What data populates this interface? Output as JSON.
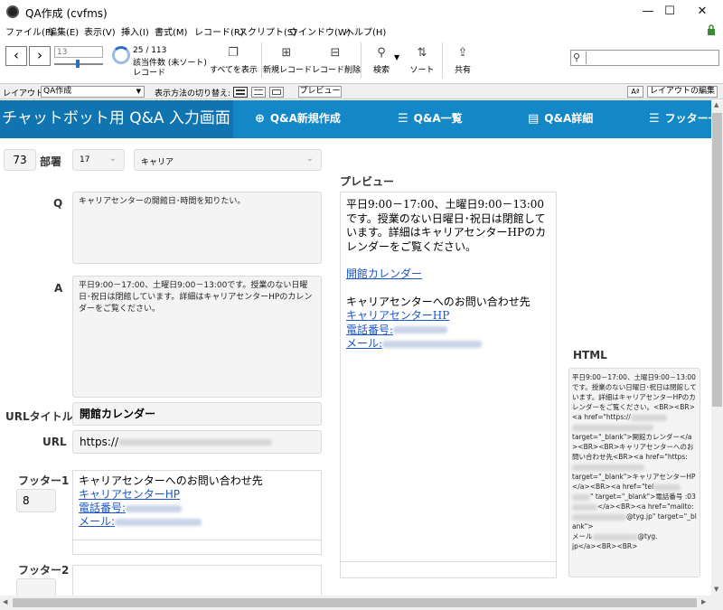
{
  "window": {
    "title": "QA作成 (cvfms)",
    "minimize": "—",
    "maximize": "☐",
    "close": "✕"
  },
  "menu": [
    "ファイル(F)",
    "編集(E)",
    "表示(V)",
    "挿入(I)",
    "書式(M)",
    "レコード(R)",
    "スクリプト(S)",
    "ウインドウ(W)",
    "ヘルプ(H)"
  ],
  "toolbar": {
    "record_number": "13",
    "found_count": "25 / 113",
    "found_label": "該当件数 (未ソート)",
    "records_label": "レコード",
    "show_all": "すべてを表示",
    "new_record": "新規レコード",
    "delete_record": "レコード削除",
    "find": "検索",
    "sort": "ソート",
    "share": "共有"
  },
  "layoutbar": {
    "layout_label": "レイアウト:",
    "layout_value": "QA作成",
    "view_as": "表示方法の切り替え:",
    "preview": "プレビュー",
    "aa": "Aª",
    "edit_layout": "レイアウトの編集"
  },
  "header": {
    "title": "チャットボット用 Q&A 入力画面",
    "nav_new": "Q&A新規作成",
    "nav_list": "Q&A一覧",
    "nav_detail": "Q&A詳細",
    "nav_footer": "フッター一"
  },
  "form": {
    "id": "73",
    "dept_label": "部署",
    "dept_code": "17",
    "dept_name": "キャリア",
    "q_label": "Q",
    "q_text": "キャリアセンターの開館日･時間を知りたい。",
    "a_label": "A",
    "a_text": "平日9:00－17:00、土曜日9:00－13:00です。授業のない日曜日･祝日は閉館しています。詳細はキャリアセンターHPのカレンダーをご覧ください。",
    "url_title_label": "URLタイトル",
    "url_title": "開館カレンダー",
    "url_label": "URL",
    "url_prefix": "https://",
    "footer1_label": "フッター1",
    "footer1_num": "8",
    "footer1_heading": "キャリアセンターへのお問い合わせ先",
    "footer1_link": "キャリアセンターHP",
    "footer1_phone": "電話番号:",
    "footer1_mail": "メール:",
    "footer2_label": "フッター2"
  },
  "preview": {
    "label": "プレビュー",
    "body": "平日9:00－17:00、土曜日9:00－13:00です。授業のない日曜日･祝日は閉館しています。詳細はキャリアセンターHPのカレンダーをご覧ください。",
    "link": "開館カレンダー",
    "footer_heading": "キャリアセンターへのお問い合わせ先",
    "footer_link": "キャリアセンターHP",
    "phone": "電話番号:",
    "mail": "メール:"
  },
  "html_panel": {
    "label": "HTML",
    "l1": "平日9:00－17:00、土曜日9:00－13:00です。授業のない日曜日･祝日は閉館しています。詳細はキャリアセンターHPのカレンダーをご覧ください。<BR><BR><a href=\"https://",
    "l2": "target=\"_blank\">開館カレンダー</a><BR><BR>キャリアセンターへのお問い合わせ先<BR><a href=\"https:",
    "l3": "target=\"_blank\">キャリアセンターHP</a><BR><a href=\"tel",
    "l4": "\" target=\"_blank\">電話番号 :03",
    "l5": "</a><BR><a href=\"mailto:",
    "l6": "@tyg.jp\" target=\"_blank\">",
    "l7": "メール",
    "l8": "@tyg.",
    "l9": "jp</a><BR><BR>"
  },
  "colors": {
    "header": "#1487c7",
    "header_title": "#0f74b0",
    "link": "#1a56c9"
  }
}
